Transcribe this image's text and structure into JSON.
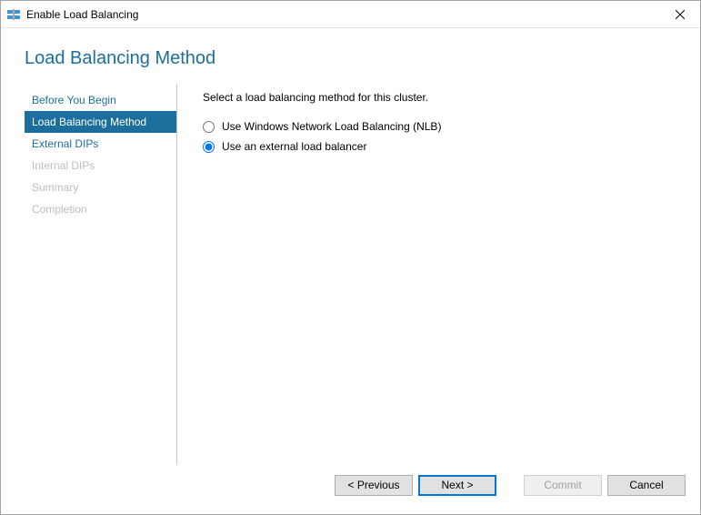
{
  "window": {
    "title": "Enable Load Balancing",
    "icon_name": "load-balancer-icon"
  },
  "page": {
    "title": "Load Balancing Method"
  },
  "sidebar": {
    "items": [
      {
        "label": "Before You Begin",
        "state": "enabled"
      },
      {
        "label": "Load Balancing Method",
        "state": "selected"
      },
      {
        "label": "External DIPs",
        "state": "enabled"
      },
      {
        "label": "Internal DIPs",
        "state": "disabled"
      },
      {
        "label": "Summary",
        "state": "disabled"
      },
      {
        "label": "Completion",
        "state": "disabled"
      }
    ]
  },
  "content": {
    "instruction": "Select a load balancing method for this cluster.",
    "options": [
      {
        "label": "Use Windows Network Load Balancing (NLB)",
        "selected": false
      },
      {
        "label": "Use an external load balancer",
        "selected": true
      }
    ]
  },
  "footer": {
    "previous": "< Previous",
    "next": "Next >",
    "commit": "Commit",
    "cancel": "Cancel",
    "commit_enabled": false
  }
}
